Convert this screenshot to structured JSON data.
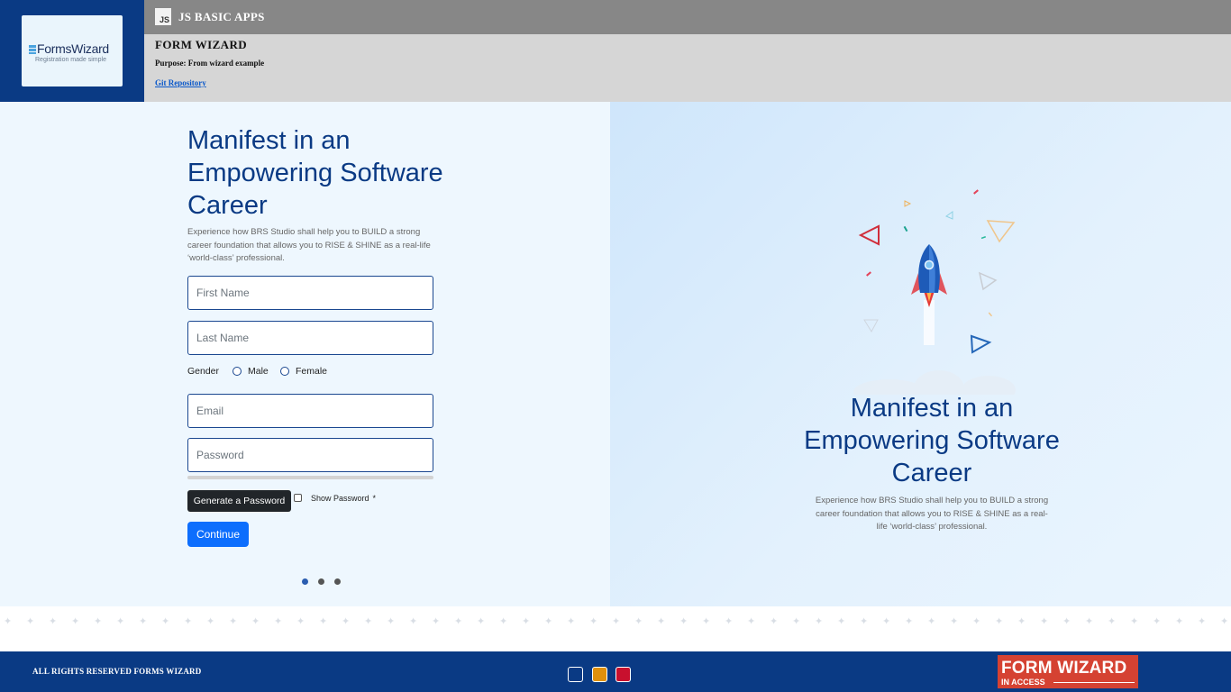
{
  "header": {
    "logo": {
      "brand": "FormsWizard",
      "tagline": "Registration made simple"
    },
    "top_bar": {
      "badge": "JS",
      "app_name": "JS BASIC APPS"
    },
    "sub_bar": {
      "title": "FORM WIZARD",
      "purpose": "Purpose: From wizard example",
      "link_label": "Git Repository"
    }
  },
  "form_panel": {
    "title": "Manifest in an Empowering Software Career",
    "description": "Experience how BRS Studio shall help you to BUILD a strong career foundation that allows you to RISE & SHINE as a real-life ‘world-class’ professional.",
    "first_name": {
      "placeholder": "First Name",
      "value": ""
    },
    "last_name": {
      "placeholder": "Last Name",
      "value": ""
    },
    "gender": {
      "label": "Gender",
      "options": [
        "Male",
        "Female"
      ],
      "selected": null
    },
    "email": {
      "placeholder": "Email",
      "value": ""
    },
    "password": {
      "placeholder": "Password",
      "value": "",
      "strength": 0
    },
    "generate_label": "Generate a Password",
    "show_password_label": "Show Password",
    "required_marker": "*",
    "continue_label": "Continue",
    "steps": {
      "total": 3,
      "current": 1
    }
  },
  "promo_panel": {
    "title": "Manifest in an Empowering Software Career",
    "description": "Experience how BRS Studio shall help you to BUILD a strong career foundation that allows you to RISE & SHINE as a real-life ‘world-class’ professional.",
    "illustration": "rocket-launch"
  },
  "footer": {
    "copyright": "ALL RIGHTS RESERVED FORMS WIZARD",
    "theme_swatches": [
      "#0a3a84",
      "#e0900c",
      "#c8102e"
    ],
    "badge": {
      "title": "FORM WIZARD",
      "subtitle": "IN ACCESS"
    }
  },
  "colors": {
    "brand_navy": "#0a3a84",
    "primary_button": "#0d6efd",
    "dark_button": "#212529",
    "badge_red": "#d54232"
  }
}
